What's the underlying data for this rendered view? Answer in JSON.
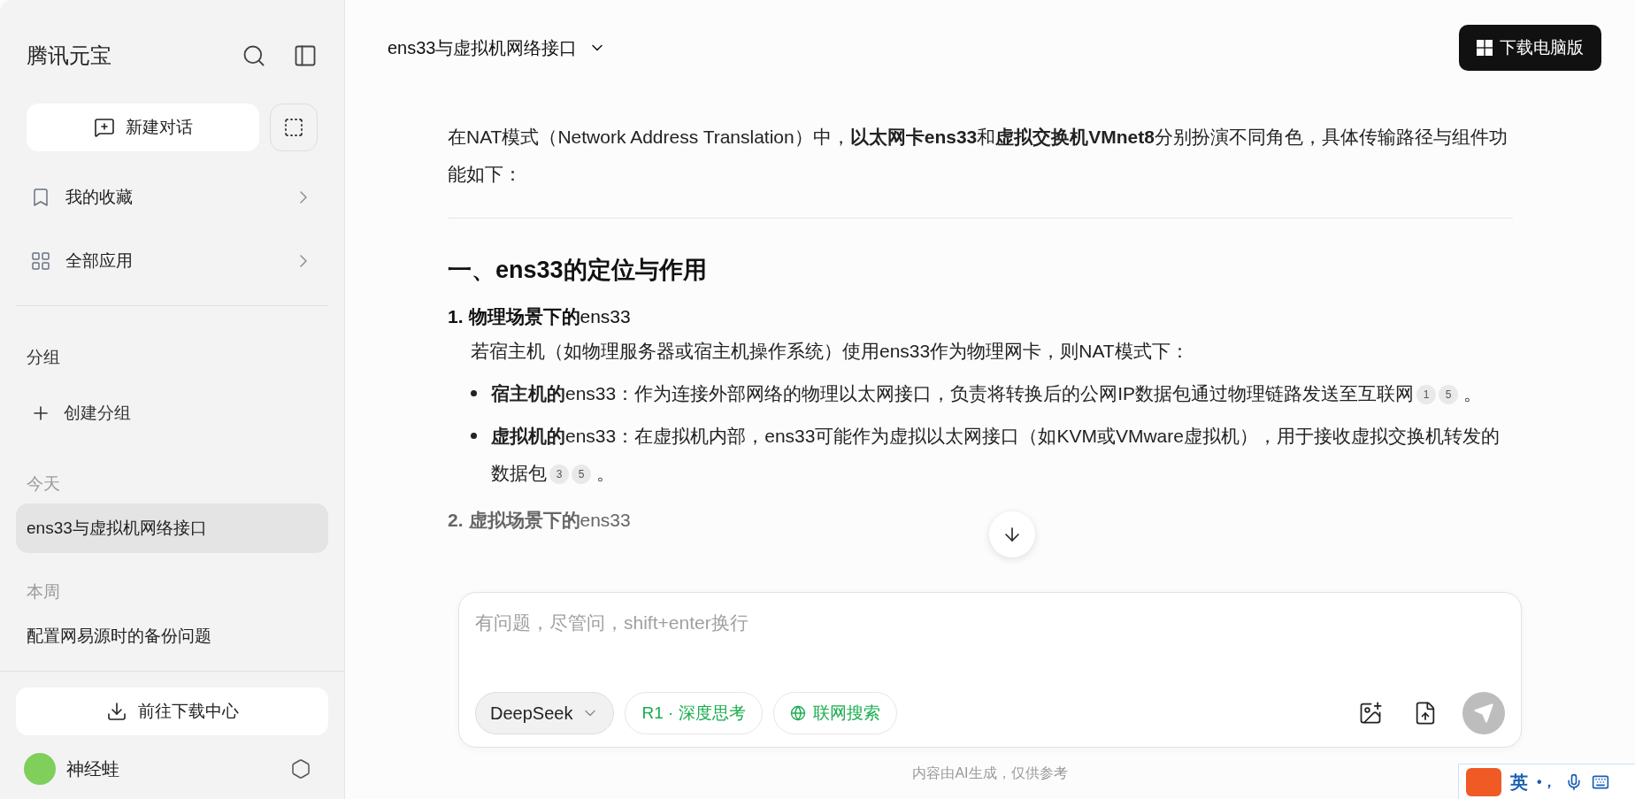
{
  "sidebar": {
    "brand": "腾讯元宝",
    "new_chat": "新建对话",
    "nav": [
      {
        "kind": "bookmark",
        "label": "我的收藏"
      },
      {
        "kind": "apps",
        "label": "全部应用"
      }
    ],
    "groups_title": "分组",
    "create_group": "创建分组",
    "sections": [
      {
        "title": "今天",
        "chats": [
          {
            "title": "ens33与虚拟机网络接口",
            "selected": true
          }
        ]
      },
      {
        "title": "本周",
        "chats": [
          {
            "title": "配置网易源时的备份问题",
            "selected": false
          }
        ]
      }
    ],
    "download_center": "前往下载中心",
    "user": {
      "name": "神经蛙"
    }
  },
  "header": {
    "title": "ens33与虚拟机网络接口",
    "download_button": "下载电脑版"
  },
  "answer": {
    "intro": "在NAT模式（Network Address Translation）中，**以太网卡ens33**和**虚拟交换机VMnet8**分别扮演不同角色，具体传输路径与组件功能如下：",
    "heading": "一、ens33的定位与作用",
    "items": [
      {
        "number": "1.",
        "title": "**物理场景下的**ens33",
        "text": "若宿主机（如物理服务器或宿主机操作系统）使用ens33作为物理网卡，则NAT模式下：",
        "bullets": [
          {
            "text": "**宿主机的**ens33：作为连接外部网络的物理以太网接口，负责将转换后的公网IP数据包通过物理链路发送至互联网",
            "citations": [
              "1",
              "5"
            ],
            "tail": "。"
          },
          {
            "text": "**虚拟机的**ens33：在虚拟机内部，ens33可能作为虚拟以太网接口（如KVM或VMware虚拟机），用于接收虚拟交换机转发的数据包",
            "citations": [
              "3",
              "5"
            ],
            "tail": "。"
          }
        ]
      },
      {
        "number": "2.",
        "title": "**虚拟场景下的**ens33"
      }
    ]
  },
  "composer": {
    "placeholder": "有问题，尽管问，shift+enter换行",
    "model": "DeepSeek",
    "chips": [
      {
        "kind": "r1",
        "label": "R1 · 深度思考"
      },
      {
        "kind": "web",
        "label": "联网搜索"
      }
    ]
  },
  "disclaimer": "内容由AI生成，仅供参考",
  "ime": {
    "mode": "英",
    "punct": "•，"
  }
}
